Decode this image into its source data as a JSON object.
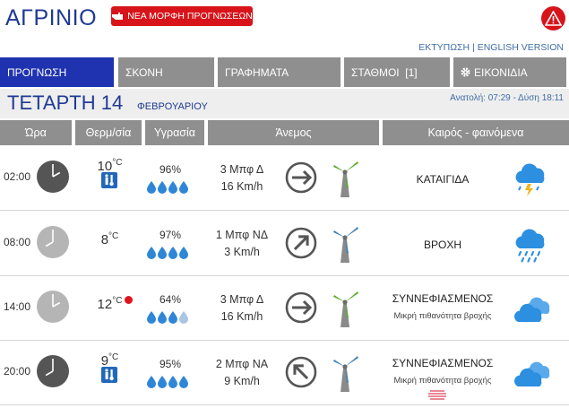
{
  "header": {
    "city": "ΑΓΡΙΝΙΟ",
    "new_format_button": "ΝΕΑ ΜΟΡΦΗ ΠΡΟΓΝΩΣΕΩΝ",
    "print_link": "ΕΚΤΥΠΩΣΗ",
    "separator": "|",
    "english_link": "ENGLISH VERSION"
  },
  "tabs": [
    {
      "label": "ΠΡΟΓΝΩΣΗ",
      "active": true
    },
    {
      "label": "ΣΚΟΝΗ",
      "active": false
    },
    {
      "label": "ΓΡΑΦΗΜΑΤΑ",
      "active": false
    },
    {
      "label": "ΣΤΑΘΜΟΙ",
      "count": "[1]",
      "active": false
    },
    {
      "label": "ΕΙΚΟΝΙΔΙΑ",
      "active": false,
      "icon": "gear-icon"
    }
  ],
  "date": {
    "day": "ΤΕΤΑΡΤΗ 14",
    "month": "ΦΕΒΡΟΥΑΡΙΟΥ",
    "sun": "Ανατολή: 07:29 - Δύση 18:11"
  },
  "columns": [
    "Ώρα",
    "Θερμ/σία",
    "Υγρασία",
    "Άνεμος",
    "Καιρός - φαινόμενα"
  ],
  "rows": [
    {
      "time": "02:00",
      "clock": "dark",
      "temp": "10",
      "unit": "°C",
      "cold_icon": true,
      "humidity": "96%",
      "drops": 4,
      "wind_bf": "3 Μπφ Δ",
      "wind_kmh": "16 Km/h",
      "wind_dir": "W",
      "turbine": "green",
      "condition": "ΚΑΤΑΙΓΙΔΑ",
      "subtext": "",
      "weather_icon": "thunderstorm-icon"
    },
    {
      "time": "08:00",
      "clock": "light",
      "temp": "8",
      "unit": "°C",
      "cold_icon": false,
      "humidity": "97%",
      "drops": 4,
      "wind_bf": "1 Μπφ ΝΔ",
      "wind_kmh": "3 Km/h",
      "wind_dir": "SW",
      "turbine": "blue",
      "condition": "ΒΡΟΧΗ",
      "subtext": "",
      "weather_icon": "rain-icon"
    },
    {
      "time": "14:00",
      "clock": "light",
      "temp": "12",
      "unit": "°C",
      "cold_icon": false,
      "warm_dot": true,
      "humidity": "64%",
      "drops": 3,
      "wind_bf": "3 Μπφ Δ",
      "wind_kmh": "16 Km/h",
      "wind_dir": "W",
      "turbine": "green",
      "condition": "ΣΥΝΝΕΦΙΑΣΜΕΝΟΣ",
      "subtext": "Μικρή πιθανότητα βροχής",
      "weather_icon": "cloudy-icon"
    },
    {
      "time": "20:00",
      "clock": "dark",
      "temp": "9",
      "unit": "°C",
      "cold_icon": true,
      "humidity": "95%",
      "drops": 4,
      "wind_bf": "2 Μπφ ΝΑ",
      "wind_kmh": "9 Km/h",
      "wind_dir": "SE",
      "turbine": "blue",
      "condition": "ΣΥΝΝΕΦΙΑΣΜΕΝΟΣ",
      "subtext": "Μικρή πιθανότητα βροχής",
      "weather_icon": "cloudy-icon",
      "fog_icon": true
    }
  ],
  "colors": {
    "brand_blue": "#1f33b0",
    "alert_red": "#d7141a",
    "tab_gray": "#8f8f8f",
    "drop_blue": "#2f86d6",
    "cloud_blue": "#2c8fe0"
  }
}
